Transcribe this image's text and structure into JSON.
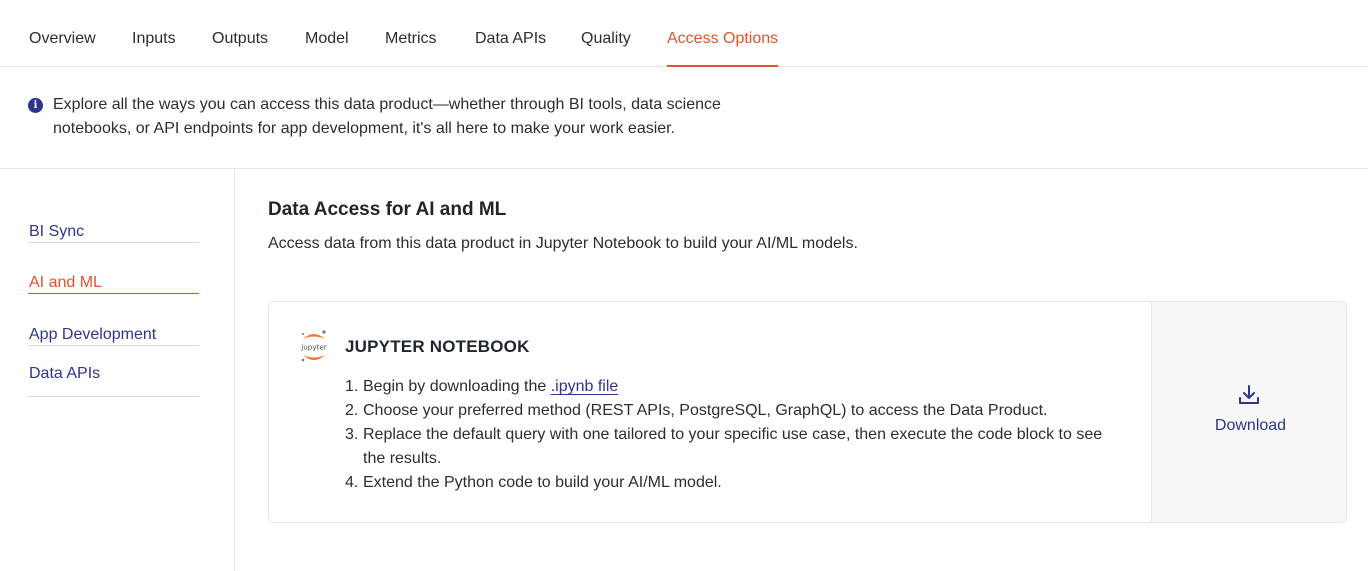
{
  "tabs": [
    {
      "label": "Overview"
    },
    {
      "label": "Inputs"
    },
    {
      "label": "Outputs"
    },
    {
      "label": "Model"
    },
    {
      "label": "Metrics"
    },
    {
      "label": "Data APIs"
    },
    {
      "label": "Quality"
    },
    {
      "label": "Access Options",
      "active": true
    }
  ],
  "info": {
    "icon": "info-icon",
    "text": "Explore all the ways you can access this data product—whether through BI tools, data science notebooks, or API endpoints for app development, it's all here to make your work easier."
  },
  "sidenav": {
    "items": [
      {
        "label": "BI Sync"
      },
      {
        "label": "AI and ML",
        "active": true
      },
      {
        "label": "App Development"
      },
      {
        "label": "Data APIs"
      }
    ]
  },
  "main": {
    "title": "Data Access for AI and ML",
    "subtitle": "Access data from this data product in Jupyter Notebook to build your AI/ML models."
  },
  "card": {
    "logo_text": "jupyter",
    "title": "JUPYTER NOTEBOOK",
    "steps": [
      {
        "num": "1.",
        "pre": "Begin by downloading the ",
        "link": ".ipynb file"
      },
      {
        "num": "2.",
        "text": "Choose your preferred method (REST APIs, PostgreSQL, GraphQL) to access the Data Product."
      },
      {
        "num": "3.",
        "text": "Replace the default query with one tailored to your specific use case, then execute the code block to see the results."
      },
      {
        "num": "4.",
        "text": "Extend the Python code to build your AI/ML model."
      }
    ],
    "download_label": "Download",
    "download_icon": "download-icon"
  },
  "colors": {
    "accent": "#e4512c",
    "link": "#2e3590",
    "border": "#e6e6e6",
    "jupyter_orange": "#f37726"
  }
}
